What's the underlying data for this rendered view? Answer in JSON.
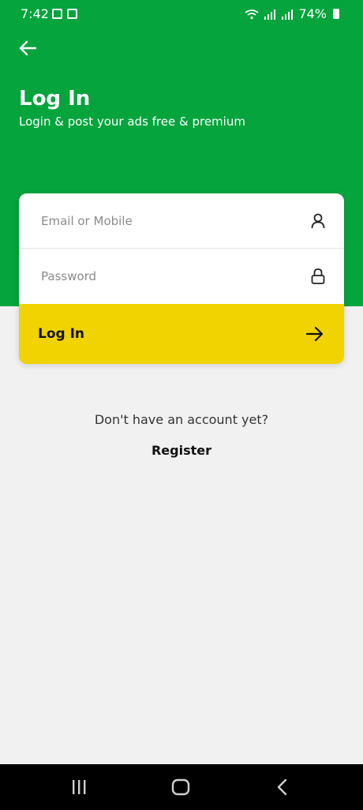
{
  "status_bar": {
    "time": "7:42",
    "battery": "74%"
  },
  "header": {
    "back_icon": "arrow-left-icon",
    "title": "Log In",
    "subtitle": "Login & post your ads free & premium",
    "background": "#05a43d"
  },
  "form": {
    "email_placeholder": "Email or Mobile",
    "email_icon": "user-icon",
    "password_placeholder": "Password",
    "password_icon": "lock-icon",
    "login_label": "Log In",
    "login_icon": "arrow-right-icon",
    "login_color": "#f1d302"
  },
  "footer": {
    "prompt": "Don't have an account yet?",
    "register_label": "Register"
  },
  "navbar": {
    "recents_icon": "recents-icon",
    "home_icon": "home-icon",
    "back_icon": "back-chevron-icon"
  }
}
